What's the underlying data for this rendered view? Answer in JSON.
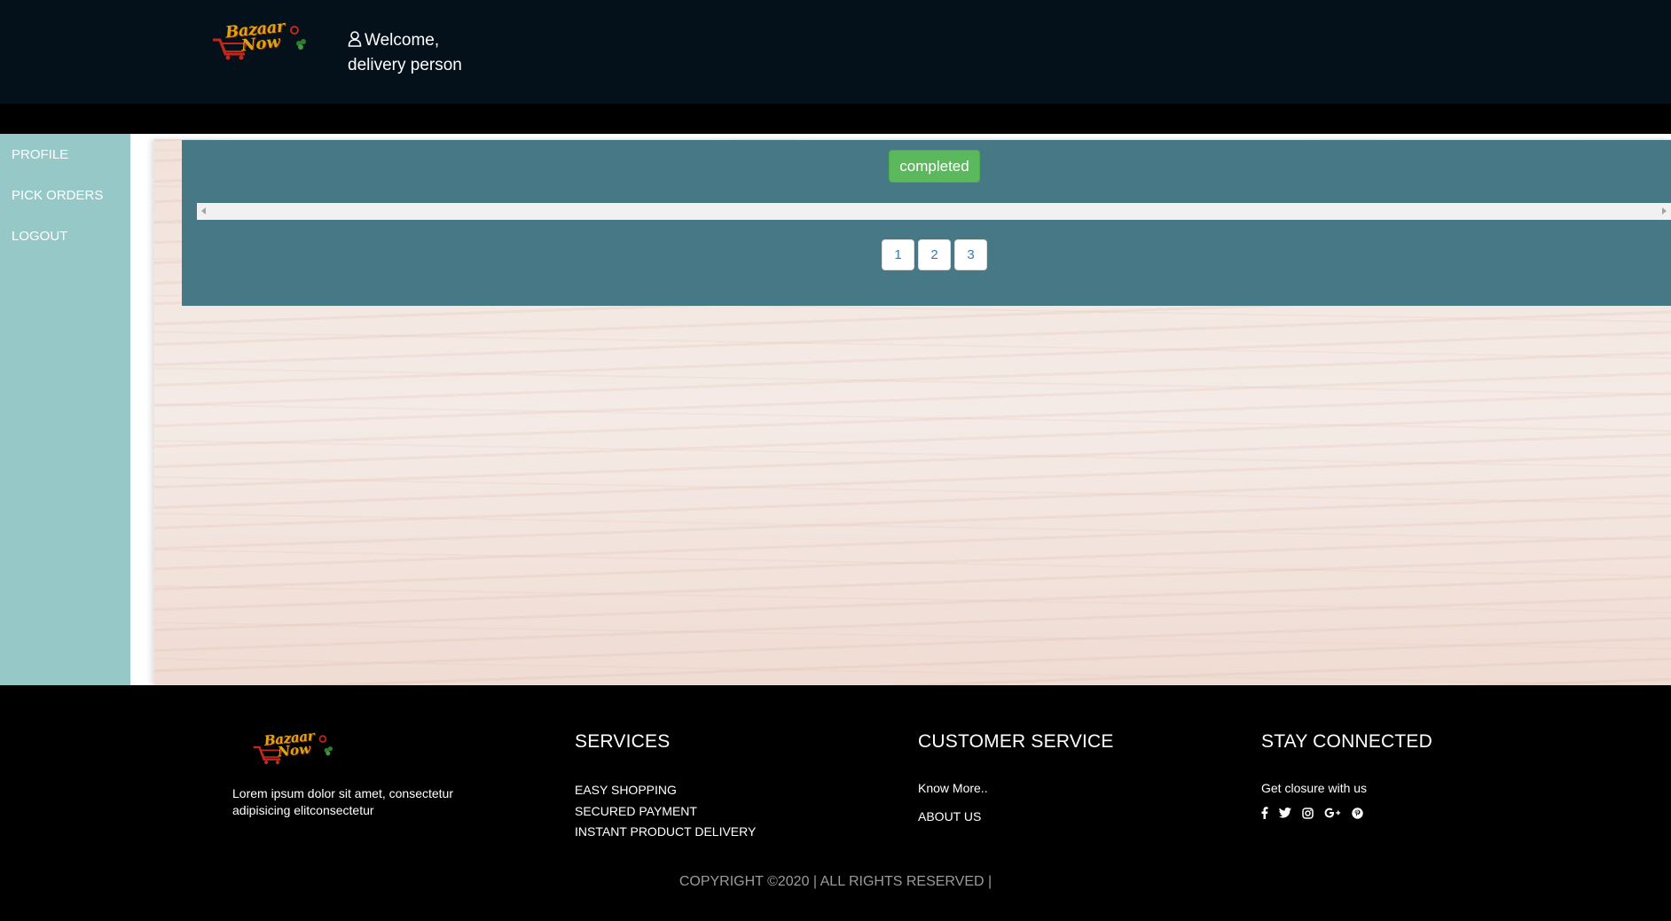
{
  "header": {
    "logo_alt": "Bazaar Now",
    "logo_line1": "Bazaar",
    "logo_line2": "Now",
    "welcome_line1": "Welcome,",
    "welcome_line2": "delivery person",
    "icons": {
      "user": "user-icon"
    }
  },
  "sidebar": {
    "items": [
      {
        "label": "PROFILE"
      },
      {
        "label": "PICK ORDERS"
      },
      {
        "label": "LOGOUT"
      }
    ]
  },
  "main": {
    "status": "completed",
    "pagination": [
      "1",
      "2",
      "3"
    ]
  },
  "footer": {
    "description": "Lorem ipsum dolor sit amet, consectetur adipisicing elitconsectetur",
    "services": {
      "heading": "SERVICES",
      "links": [
        "EASY SHOPPING",
        "SECURED PAYMENT",
        "INSTANT PRODUCT DELIVERY"
      ]
    },
    "customer_service": {
      "heading": "CUSTOMER SERVICE",
      "links": [
        "Know More..",
        "ABOUT US"
      ]
    },
    "stay_connected": {
      "heading": "STAY CONNECTED",
      "text": "Get closure with us",
      "social_icons": [
        "facebook-icon",
        "twitter-icon",
        "instagram-icon",
        "google-plus-icon",
        "pinterest-icon"
      ]
    },
    "copyright": "COPYRIGHT ©2020 | ALL RIGHTS RESERVED |"
  },
  "colors": {
    "header_bg": "#04111b",
    "sidebar_bg": "#95c8c6",
    "panel_bg": "#467985",
    "status_badge": "#5cb85c",
    "pagination_text": "#337ab7",
    "footer_bg": "#000000"
  }
}
